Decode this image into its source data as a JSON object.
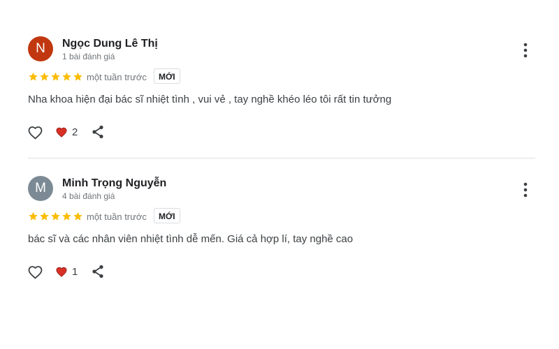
{
  "reviews": [
    {
      "avatar_letter": "N",
      "avatar_color": "#c1370f",
      "name": "Ngọc Dung Lê Thị",
      "review_count": "1 bài đánh giá",
      "rating": 5,
      "time": "một tuần trước",
      "badge": "MỚI",
      "text": "Nha khoa hiện đại bác sĩ nhiệt tình , vui vẻ , tay nghề khéo léo tôi rất tin tưởng",
      "reactions": "2"
    },
    {
      "avatar_letter": "M",
      "avatar_color": "#7b8a94",
      "name": "Minh Trọng Nguyễn",
      "review_count": "4 bài đánh giá",
      "rating": 5,
      "time": "một tuần trước",
      "badge": "MỚI",
      "text": "bác sĩ và các nhân viên nhiệt tình dễ mến. Giá cả hợp lí, tay nghề cao",
      "reactions": "1"
    }
  ],
  "colors": {
    "star": "#fbbc04",
    "heart": "#d93025",
    "icon": "#3c4043"
  },
  "icons": {
    "more": "more-vert-icon",
    "like": "heart-outline-icon",
    "reaction": "heart-filled-icon",
    "share": "share-icon",
    "star": "star-icon"
  }
}
